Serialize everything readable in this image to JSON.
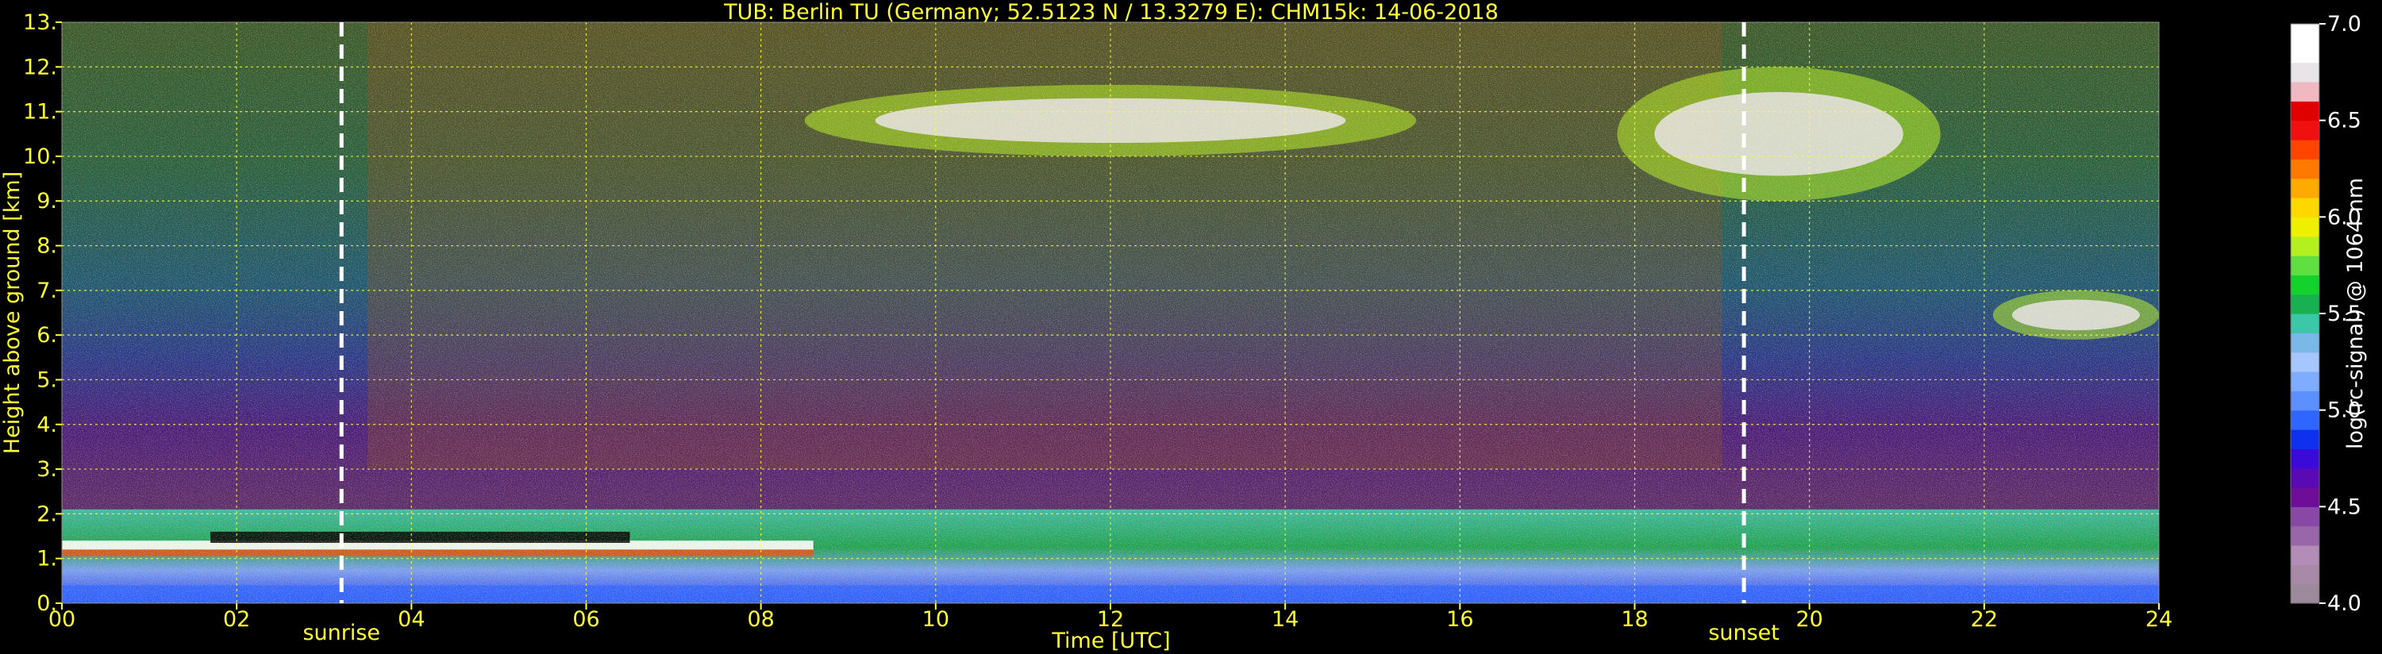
{
  "theme": {
    "background": "#000000",
    "text": "#ffff33",
    "cbar_text": "#ffffff",
    "grid": "#ffff33",
    "marker_line": "#ffffff"
  },
  "chart_data": {
    "type": "heatmap",
    "title": "TUB: Berlin TU (Germany; 52.5123 N / 13.3279 E):    CHM15k: 14-06-2018",
    "xlabel": "Time [UTC]",
    "ylabel": "Height above ground [km]",
    "xlim": [
      0,
      24
    ],
    "ylim": [
      0,
      13
    ],
    "xticks": [
      "00",
      "02",
      "04",
      "06",
      "08",
      "10",
      "12",
      "14",
      "16",
      "18",
      "20",
      "22",
      "24"
    ],
    "yticks": [
      "0.",
      "1.",
      "2.",
      "3.",
      "4.",
      "5.",
      "6.",
      "7.",
      "8.",
      "9.",
      "10.",
      "11.",
      "12.",
      "13."
    ],
    "grid": true,
    "markers": [
      {
        "label": "sunrise",
        "time": 3.2
      },
      {
        "label": "sunset",
        "time": 19.25
      }
    ],
    "colorbar": {
      "label": "log(rc-signal) @ 1064 nm",
      "range": [
        4.0,
        7.0
      ],
      "ticks": [
        "4.0",
        "4.5",
        "5.0",
        "5.5",
        "6.0",
        "6.5",
        "7.0"
      ],
      "colors": [
        "#9c8a9c",
        "#a88aa8",
        "#b48cb8",
        "#9a66aa",
        "#8a48a6",
        "#6e0e98",
        "#5a0ab4",
        "#3a0ad8",
        "#1030f0",
        "#2f66ff",
        "#5c8fff",
        "#7eacff",
        "#a6c6ff",
        "#7ab8e8",
        "#3cc8a8",
        "#18b050",
        "#14d22c",
        "#60e040",
        "#b4f020",
        "#eef000",
        "#ffd800",
        "#ffaa00",
        "#ff7800",
        "#ff4400",
        "#f01010",
        "#e00000",
        "#f0b8c0",
        "#e8e4e8",
        "#ffffff",
        "#ffffff"
      ]
    },
    "features": [
      {
        "name": "boundary layer aerosol",
        "time": [
          0,
          24
        ],
        "height_km": [
          0.0,
          2.1
        ],
        "level": 5.3
      },
      {
        "name": "cirrus cloud",
        "time": [
          8.5,
          15.5
        ],
        "height_km": [
          10.0,
          11.6
        ],
        "level": 6.8
      },
      {
        "name": "cirrus cloud",
        "time": [
          17.8,
          21.5
        ],
        "height_km": [
          9.0,
          12.0
        ],
        "level": 6.8
      },
      {
        "name": "mid-level cloud",
        "time": [
          22.1,
          24
        ],
        "height_km": [
          5.9,
          7.0
        ],
        "level": 6.8
      }
    ]
  }
}
